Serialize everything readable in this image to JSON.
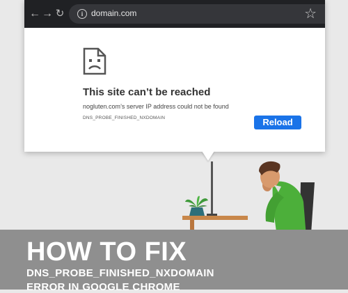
{
  "browser": {
    "back_icon": "arrow-left-icon",
    "forward_icon": "arrow-right-icon",
    "reload_icon": "reload-icon",
    "info_icon": "info-icon",
    "bookmark_icon": "star-icon",
    "url": "domain.com"
  },
  "error_page": {
    "icon": "sad-document-icon",
    "title": "This site can’t be reached",
    "description": "nogluten.com’s server IP address could not be found",
    "code": "DNS_PROBE_FINISHED_NXDOMAIN",
    "reload_label": "Reload",
    "accent_color": "#1a73e8"
  },
  "banner": {
    "headline": "HOW TO FIX",
    "subhead": "DNS_PROBE_FINISHED_NXDOMAIN",
    "subhead2": "ERROR IN GOOGLE CHROME"
  },
  "colors": {
    "toolbar": "#202124",
    "background": "#e9e9e9",
    "band": "#8f8f8f",
    "shirt": "#4caf3a"
  }
}
